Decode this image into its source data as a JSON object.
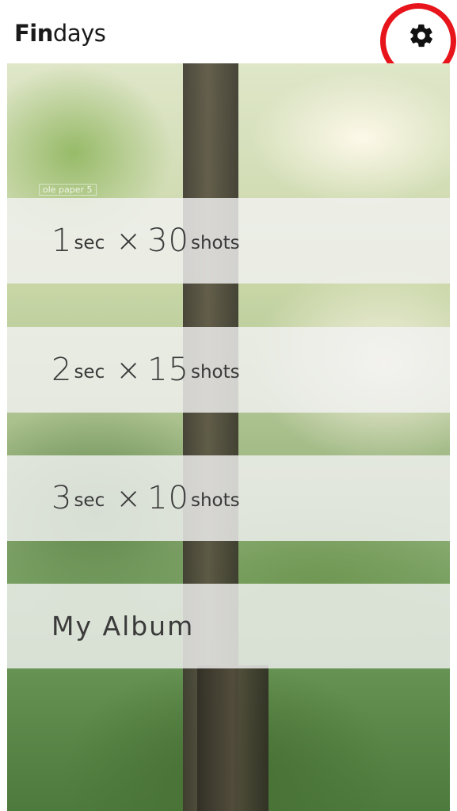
{
  "app": {
    "title_bold": "Fin",
    "title_light": "days",
    "settings_icon": "gear-icon",
    "highlight_color": "#e8141b"
  },
  "background": {
    "watermark": "ole paper 5"
  },
  "menu": {
    "items": [
      {
        "num": "1",
        "unit": "sec",
        "times": "×",
        "count": "30",
        "count_unit": "shots"
      },
      {
        "num": "2",
        "unit": "sec",
        "times": "×",
        "count": "15",
        "count_unit": "shots"
      },
      {
        "num": "3",
        "unit": "sec",
        "times": "×",
        "count": "10",
        "count_unit": "shots"
      }
    ],
    "album_label": "My Album"
  }
}
